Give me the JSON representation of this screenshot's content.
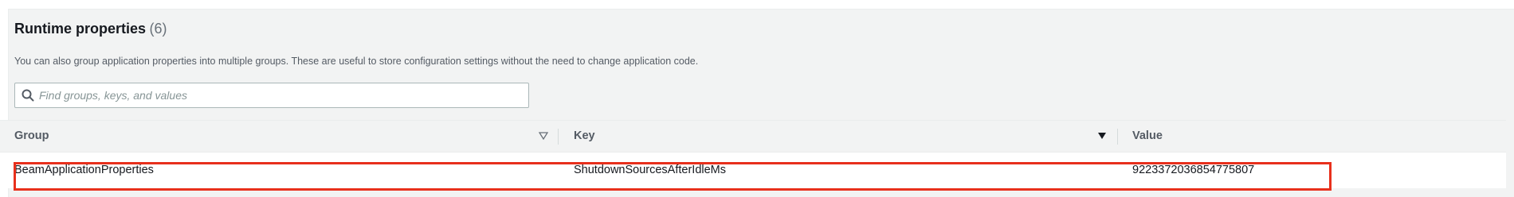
{
  "panel": {
    "title": "Runtime properties",
    "count": "(6)",
    "description": "You can also group application properties into multiple groups. These are useful to store configuration settings without the need to change application code.",
    "search": {
      "placeholder": "Find groups, keys, and values",
      "value": ""
    }
  },
  "table": {
    "columns": [
      {
        "label": "Group",
        "sort": "unsorted"
      },
      {
        "label": "Key",
        "sort": "sorted-descending"
      },
      {
        "label": "Value",
        "sort": "none"
      }
    ],
    "rows": [
      {
        "group": "BeamApplicationProperties",
        "key": "ShutdownSourcesAfterIdleMs",
        "value": "9223372036854775807"
      }
    ]
  },
  "highlight": {
    "color": "#e8301c"
  }
}
